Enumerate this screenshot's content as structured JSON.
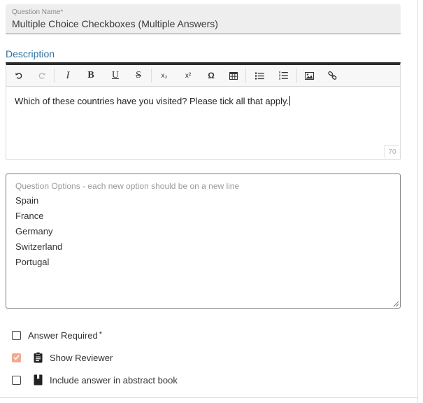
{
  "question_name": {
    "label": "Question Name*",
    "value": "Multiple Choice Checkboxes (Multiple Answers)"
  },
  "description": {
    "label": "Description",
    "toolbar": [
      {
        "name": "undo-button",
        "icon": "undo-icon",
        "glyph": "↶"
      },
      {
        "name": "redo-button",
        "icon": "redo-icon",
        "glyph": "↷"
      },
      {
        "name": "italic-button",
        "icon": "italic-icon",
        "glyph": "I"
      },
      {
        "name": "bold-button",
        "icon": "bold-icon",
        "glyph": "B"
      },
      {
        "name": "underline-button",
        "icon": "underline-icon",
        "glyph": "U"
      },
      {
        "name": "strikethrough-button",
        "icon": "strikethrough-icon",
        "glyph": "S"
      },
      {
        "name": "subscript-button",
        "icon": "subscript-icon",
        "glyph": "x₂"
      },
      {
        "name": "superscript-button",
        "icon": "superscript-icon",
        "glyph": "x²"
      },
      {
        "name": "special-char-button",
        "icon": "omega-icon",
        "glyph": "Ω"
      },
      {
        "name": "table-button",
        "icon": "table-icon",
        "glyph": "▦"
      },
      {
        "name": "bullet-list-button",
        "icon": "bullet-list-icon",
        "glyph": "☰"
      },
      {
        "name": "numbered-list-button",
        "icon": "numbered-list-icon",
        "glyph": "☷"
      },
      {
        "name": "image-button",
        "icon": "image-icon",
        "glyph": "▣"
      },
      {
        "name": "link-button",
        "icon": "link-icon",
        "glyph": "⚭"
      }
    ],
    "text": "Which of these countries have you visited? Please tick all that apply.",
    "char_count": "70"
  },
  "options": {
    "placeholder": "Question Options - each new option should be on a new line",
    "items": [
      "Spain",
      "France",
      "Germany",
      "Switzerland",
      "Portugal"
    ]
  },
  "checkboxes": {
    "answer_required": {
      "label": "Answer Required",
      "star": "*",
      "checked": false
    },
    "show_reviewer": {
      "label": "Show Reviewer",
      "checked": true
    },
    "include_abstract": {
      "label": "Include answer in abstract book",
      "checked": false
    }
  },
  "colors": {
    "accent_label": "#2f6f9f",
    "checked_box": "#f3a98e",
    "toolbar_border": "#2a2a2a"
  }
}
